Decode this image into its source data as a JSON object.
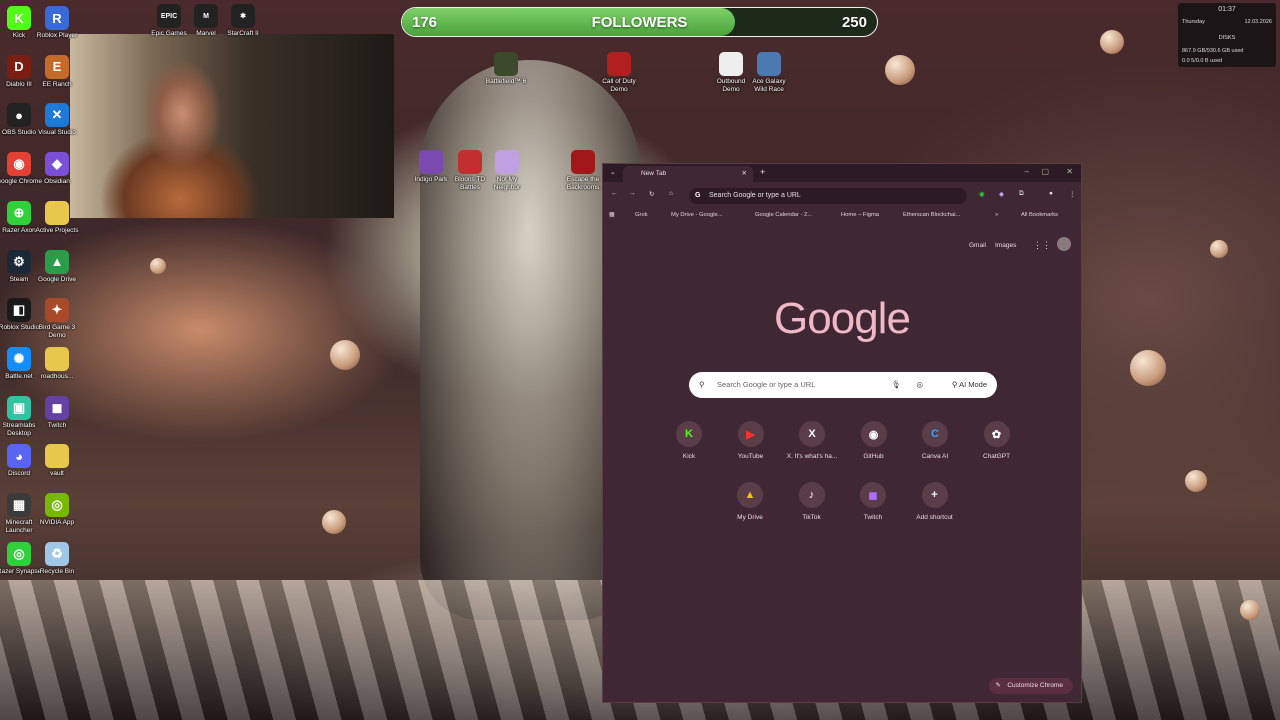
{
  "follower_goal": {
    "current": "176",
    "label": "FOLLOWERS",
    "goal": "250",
    "progress": 0.7
  },
  "system_widget": {
    "time": "01:37",
    "day": "Thursday",
    "date": "12.03.2026",
    "section": "DISKS",
    "disk1": "867.9 GB/930.6 GB used",
    "disk2": "0.0 5/0.0 B used"
  },
  "desktop_left": [
    {
      "label": "Kick",
      "icon": "kick-icon",
      "color": "#53fc18",
      "glyph": "K"
    },
    {
      "label": "Roblox Player",
      "icon": "roblox-icon",
      "color": "#3a6ad8",
      "glyph": "R"
    },
    {
      "label": "Diablo III",
      "icon": "diablo-icon",
      "color": "#7a1e12",
      "glyph": "D"
    },
    {
      "label": "EE Ranch",
      "icon": "ee-ranch-icon",
      "color": "#c46b2a",
      "glyph": "E"
    },
    {
      "label": "OBS Studio",
      "icon": "obs-icon",
      "color": "#222",
      "glyph": "●"
    },
    {
      "label": "Visual Studio",
      "icon": "vscode-icon",
      "color": "#1e7ad6",
      "glyph": "✕"
    },
    {
      "label": "Google Chrome",
      "icon": "chrome-icon",
      "color": "#e34133",
      "glyph": "◉"
    },
    {
      "label": "Obsidian",
      "icon": "obsidian-icon",
      "color": "#7b4fd8",
      "glyph": "◆"
    },
    {
      "label": "Razer Axon",
      "icon": "razer-axon-icon",
      "color": "#2fd03a",
      "glyph": "⊕"
    },
    {
      "label": "Active Projects",
      "icon": "folder-icon",
      "color": "#e8c84a",
      "glyph": ""
    },
    {
      "label": "Steam",
      "icon": "steam-icon",
      "color": "#1b2838",
      "glyph": "⚙"
    },
    {
      "label": "Google Drive",
      "icon": "drive-icon",
      "color": "#2a9d4a",
      "glyph": "▲"
    },
    {
      "label": "Roblox Studio",
      "icon": "roblox-studio-icon",
      "color": "#1a1a1a",
      "glyph": "◧"
    },
    {
      "label": "Bird Game 3 Demo",
      "icon": "bird-game-icon",
      "color": "#a84a2a",
      "glyph": "✦"
    },
    {
      "label": "Battle.net",
      "icon": "battlenet-icon",
      "color": "#148eff",
      "glyph": "✺"
    },
    {
      "label": "roadhous...",
      "icon": "folder-icon",
      "color": "#e8c84a",
      "glyph": ""
    },
    {
      "label": "Streamlabs Desktop",
      "icon": "streamlabs-icon",
      "color": "#31c3a2",
      "glyph": "▣"
    },
    {
      "label": "Twitch",
      "icon": "twitch-icon",
      "color": "#6441a5",
      "glyph": "◼"
    },
    {
      "label": "Discord",
      "icon": "discord-icon",
      "color": "#5865f2",
      "glyph": "◕"
    },
    {
      "label": "vault",
      "icon": "folder-icon",
      "color": "#e8c84a",
      "glyph": ""
    },
    {
      "label": "Minecraft Launcher",
      "icon": "minecraft-icon",
      "color": "#3b3b3b",
      "glyph": "▦"
    },
    {
      "label": "NVIDIA App",
      "icon": "nvidia-icon",
      "color": "#76b900",
      "glyph": "◎"
    },
    {
      "label": "Razer Synapse",
      "icon": "razer-icon",
      "color": "#2fd03a",
      "glyph": "◎"
    },
    {
      "label": "Recycle Bin",
      "icon": "recycle-bin-icon",
      "color": "#9fc8e8",
      "glyph": "♻"
    }
  ],
  "desktop_top": [
    {
      "label": "Epic Games",
      "icon": "epic-icon",
      "glyph": "EPIC"
    },
    {
      "label": "Marvel",
      "icon": "marvel-icon",
      "glyph": "M"
    },
    {
      "label": "StarCraft II",
      "icon": "starcraft-icon",
      "glyph": "✱"
    }
  ],
  "desktop_mid": [
    {
      "label": "Battlefield™ 6",
      "icon": "battlefield-icon"
    },
    {
      "label": "Call of Duty Demo",
      "icon": "cod-icon"
    },
    {
      "label": "Outbound Demo",
      "icon": "outbound-icon"
    },
    {
      "label": "Ace Galaxy Wild Race",
      "icon": "ace-galaxy-icon"
    },
    {
      "label": "Indigo Park",
      "icon": "indigo-park-icon"
    },
    {
      "label": "Bloons TD Battles",
      "icon": "bloons-icon"
    },
    {
      "label": "Not My Neighbor",
      "icon": "neighbor-icon"
    },
    {
      "label": "Escape the Backrooms",
      "icon": "backrooms-icon"
    }
  ],
  "chrome": {
    "tab_title": "New Tab",
    "omnibox_placeholder": "Search Google or type a URL",
    "bookmarks": [
      "Grok",
      "My Drive - Google...",
      "Google Calendar - 2...",
      "Home – Figma",
      "Etherscan Blockchai..."
    ],
    "all_bookmarks": "All Bookmarks",
    "gmail": "Gmail",
    "images": "Images",
    "logo": "Google",
    "search_placeholder": "Search Google or type a URL",
    "ai_mode": "AI Mode",
    "shortcuts": [
      {
        "label": "Kick",
        "icon": "kick-icon",
        "glyph": "K",
        "color": "#53fc18"
      },
      {
        "label": "YouTube",
        "icon": "youtube-icon",
        "glyph": "▶",
        "color": "#ff3030"
      },
      {
        "label": "X. It's what's ha...",
        "icon": "x-icon",
        "glyph": "X",
        "color": "#ffffff"
      },
      {
        "label": "GitHub",
        "icon": "github-icon",
        "glyph": "◉",
        "color": "#ffffff"
      },
      {
        "label": "Canva AI",
        "icon": "canva-icon",
        "glyph": "C",
        "color": "#35a7ff"
      },
      {
        "label": "ChatGPT",
        "icon": "chatgpt-icon",
        "glyph": "✿",
        "color": "#ffffff"
      },
      {
        "label": "My Drive",
        "icon": "drive-icon",
        "glyph": "▲",
        "color": "#f4c20d"
      },
      {
        "label": "TikTok",
        "icon": "tiktok-icon",
        "glyph": "♪",
        "color": "#ffffff"
      },
      {
        "label": "Twitch",
        "icon": "twitch-icon",
        "glyph": "◼",
        "color": "#a970ff"
      },
      {
        "label": "Add shortcut",
        "icon": "plus-icon",
        "glyph": "+",
        "color": "#ffffff"
      }
    ],
    "customize": "Customize Chrome"
  }
}
